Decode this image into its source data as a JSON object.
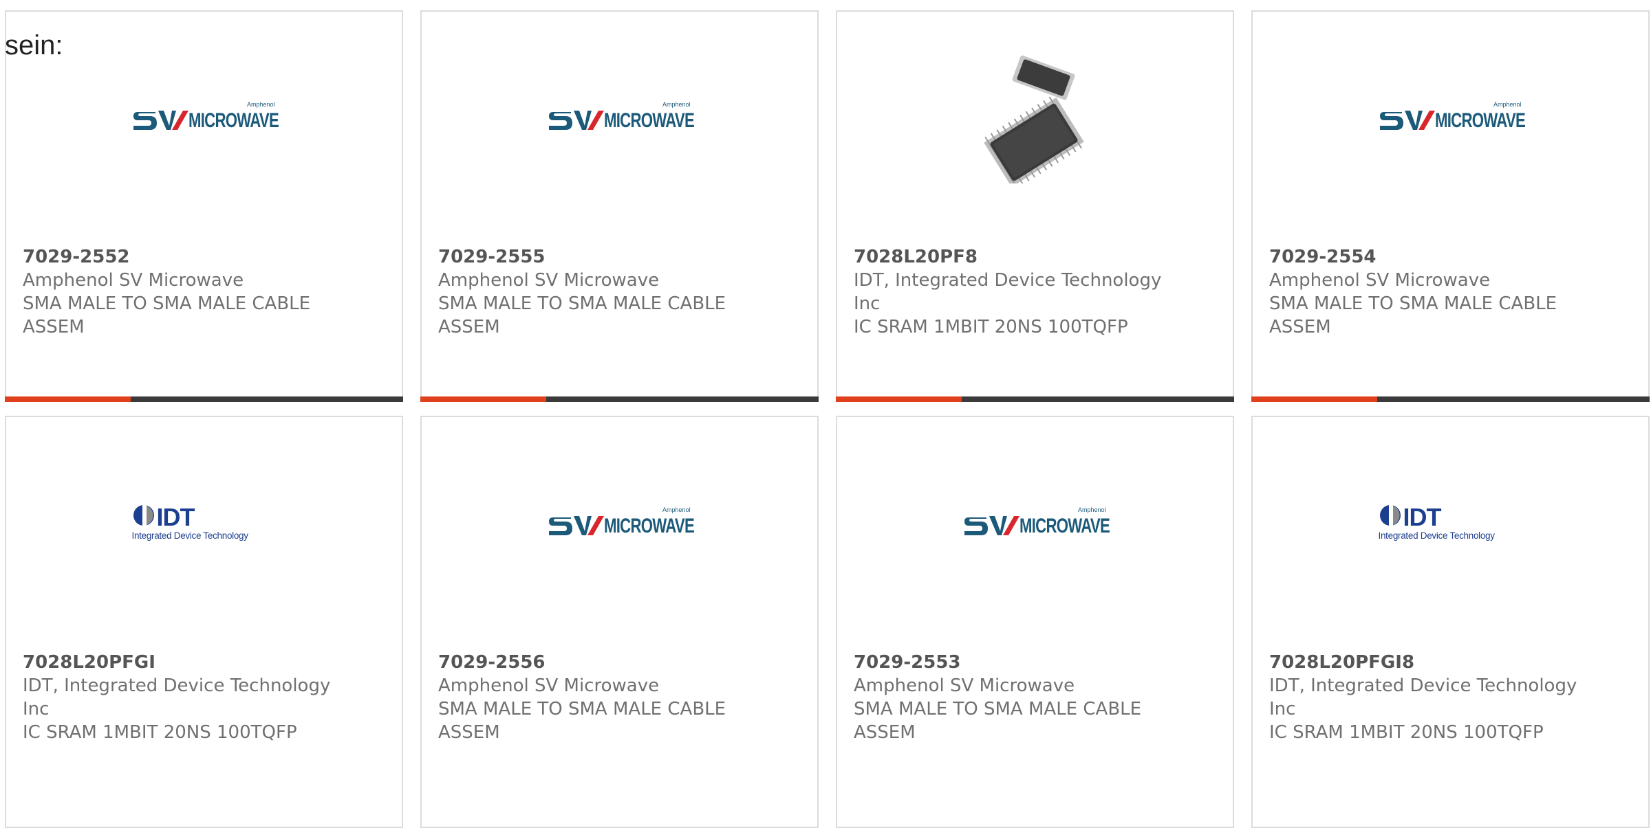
{
  "heading": "sein:",
  "colors": {
    "accent": "#e0401c",
    "bar": "#3a3a3a",
    "border": "#dcdcdc",
    "text": "#707070",
    "logo_blue": "#1c5a7a",
    "logo_red": "#d8262d",
    "idt_blue": "#1d3f8f"
  },
  "products": [
    {
      "part": "7029-2552",
      "manufacturer": "Amphenol SV Microwave",
      "description": "SMA MALE TO SMA MALE CABLE ASSEM",
      "image": "sv-microwave-logo",
      "logo_word": "MICROWAVE",
      "logo_small": "Amphenol"
    },
    {
      "part": "7029-2555",
      "manufacturer": "Amphenol SV Microwave",
      "description": "SMA MALE TO SMA MALE CABLE ASSEM",
      "image": "sv-microwave-logo",
      "logo_word": "MICROWAVE",
      "logo_small": "Amphenol"
    },
    {
      "part": "7028L20PF8",
      "manufacturer": "IDT, Integrated Device Technology Inc",
      "description": "IC SRAM 1MBIT 20NS 100TQFP",
      "image": "tqfp-chip-photo"
    },
    {
      "part": "7029-2554",
      "manufacturer": "Amphenol SV Microwave",
      "description": "SMA MALE TO SMA MALE CABLE ASSEM",
      "image": "sv-microwave-logo",
      "logo_word": "MICROWAVE",
      "logo_small": "Amphenol"
    },
    {
      "part": "7028L20PFGI",
      "manufacturer": "IDT, Integrated Device Technology Inc",
      "description": "IC SRAM 1MBIT 20NS 100TQFP",
      "image": "idt-logo",
      "logo_word": "IDT",
      "logo_small": "Integrated Device Technology"
    },
    {
      "part": "7029-2556",
      "manufacturer": "Amphenol SV Microwave",
      "description": "SMA MALE TO SMA MALE CABLE ASSEM",
      "image": "sv-microwave-logo",
      "logo_word": "MICROWAVE",
      "logo_small": "Amphenol"
    },
    {
      "part": "7029-2553",
      "manufacturer": "Amphenol SV Microwave",
      "description": "SMA MALE TO SMA MALE CABLE ASSEM",
      "image": "sv-microwave-logo",
      "logo_word": "MICROWAVE",
      "logo_small": "Amphenol"
    },
    {
      "part": "7028L20PFGI8",
      "manufacturer": "IDT, Integrated Device Technology Inc",
      "description": "IC SRAM 1MBIT 20NS 100TQFP",
      "image": "idt-logo",
      "logo_word": "IDT",
      "logo_small": "Integrated Device Technology"
    }
  ]
}
